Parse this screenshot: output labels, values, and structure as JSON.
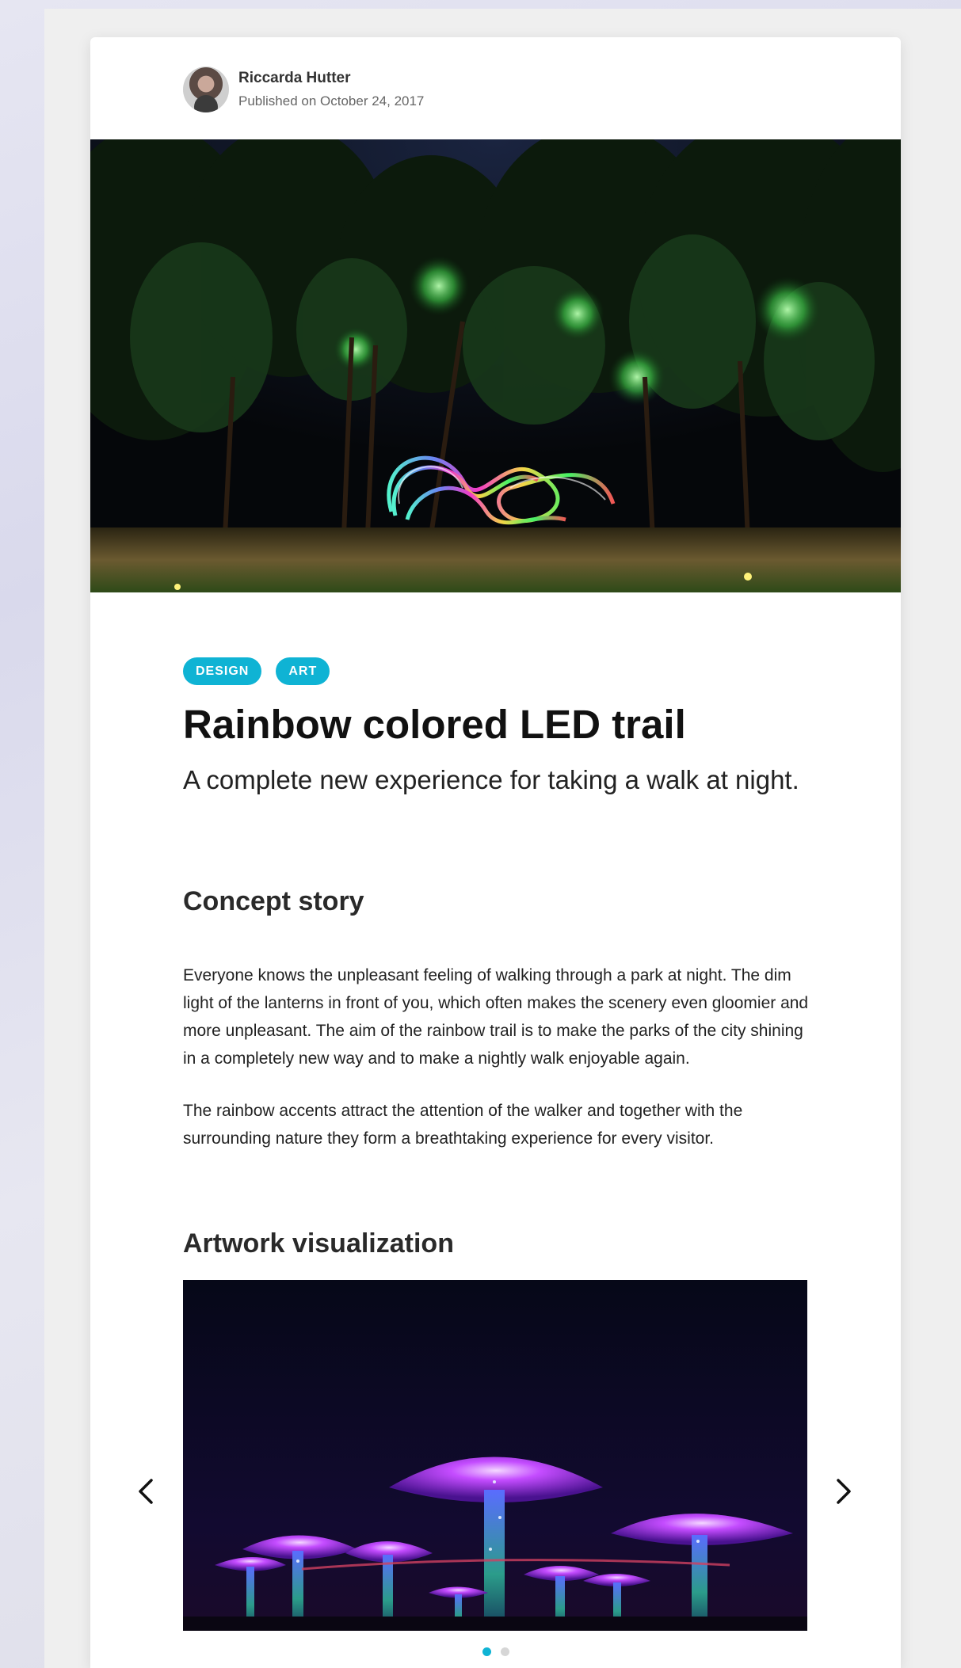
{
  "author": {
    "name": "Riccarda Hutter",
    "published": "Published on October 24, 2017"
  },
  "article": {
    "tags": [
      "DESIGN",
      "ART"
    ],
    "title": "Rainbow colored LED trail",
    "subtitle": "A complete new experience for taking a walk at night.",
    "sections": [
      {
        "heading": "Concept story",
        "paragraphs": [
          "Everyone knows the unpleasant feeling of walking through a park at night. The dim light of the lanterns in front of you, which often makes the scenery even gloomier and more unpleasant. The aim of the rainbow trail is to make the parks of the city shining in a completely new way and to make a nightly walk enjoyable again.",
          "The rainbow accents attract the attention of the walker and together with the surrounding nature they form a breathtaking experience for every visitor."
        ]
      },
      {
        "heading": "Artwork visualization"
      }
    ]
  },
  "carousel": {
    "slide_count": 2,
    "active_slide": 1
  },
  "colors": {
    "accent": "#0fb3d4",
    "title": "#111111",
    "body_text": "#222222",
    "dot_inactive": "#d6d6d6"
  },
  "icons": {
    "prev": "chevron-left-icon",
    "next": "chevron-right-icon"
  }
}
